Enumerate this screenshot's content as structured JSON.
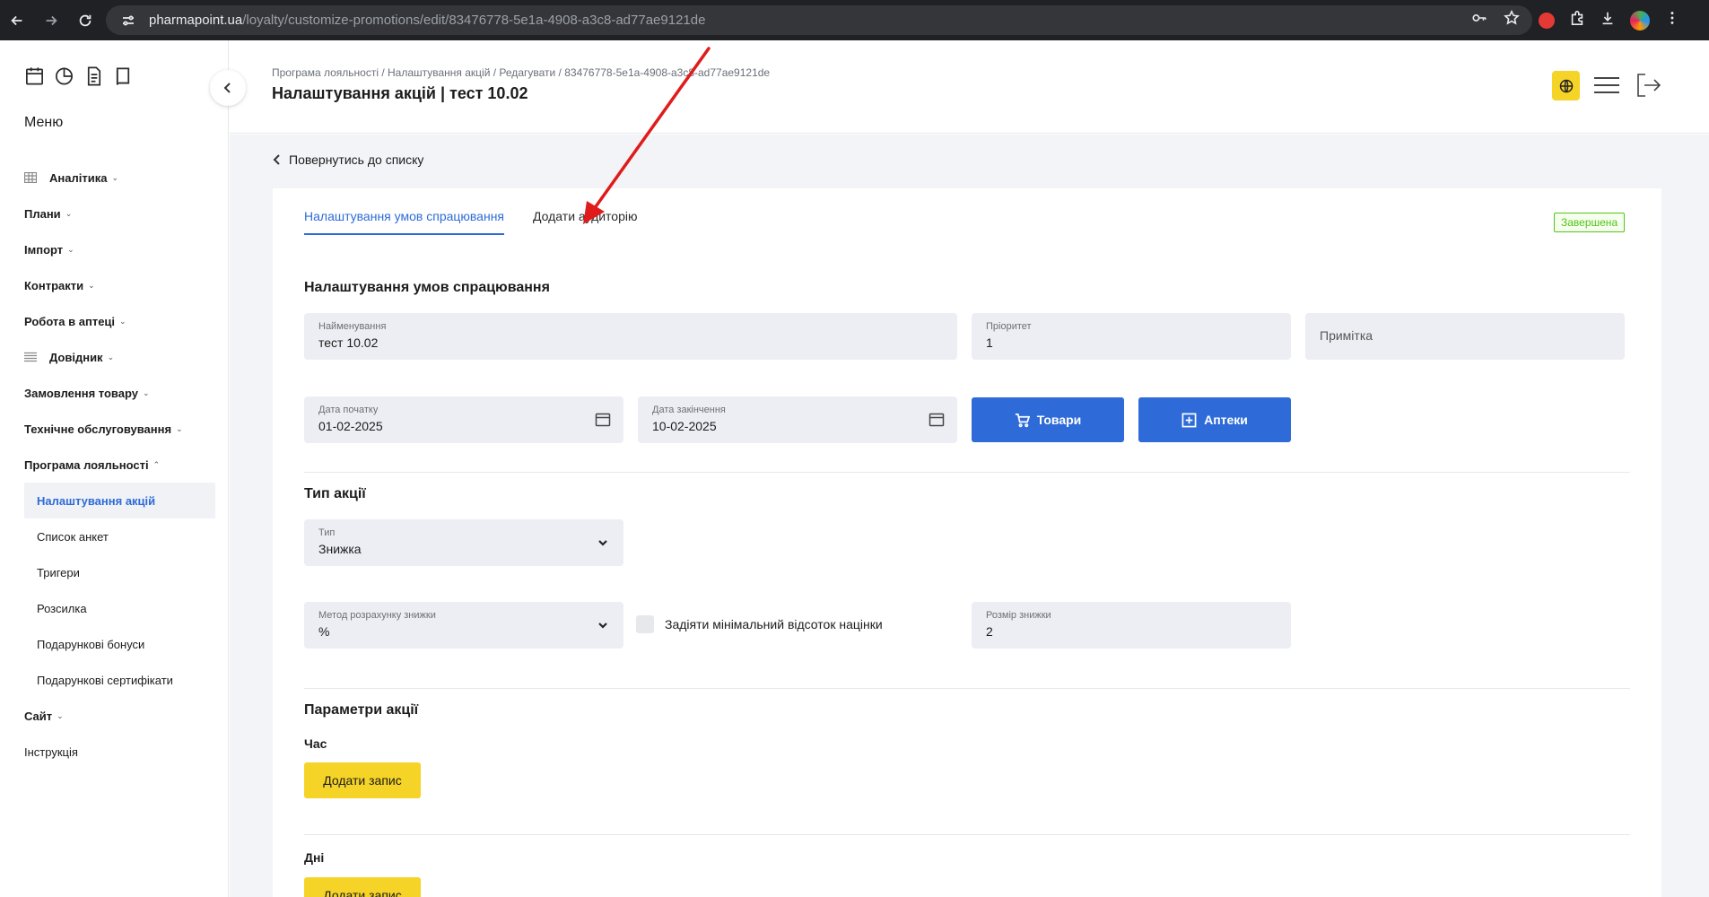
{
  "browser": {
    "url_host": "pharmapoint.ua",
    "url_path": "/loyalty/customize-promotions/edit/83476778-5e1a-4908-a3c8-ad77ae9121de"
  },
  "sidebar": {
    "menu_title": "Меню",
    "items": [
      {
        "label": "Аналітика",
        "icon": "table-icon"
      },
      {
        "label": "Плани"
      },
      {
        "label": "Імпорт"
      },
      {
        "label": "Контракти"
      },
      {
        "label": "Робота в аптеці"
      },
      {
        "label": "Довідник",
        "icon": "list-icon"
      },
      {
        "label": "Замовлення товару"
      },
      {
        "label": "Технічне обслуговування"
      },
      {
        "label": "Програма лояльності"
      }
    ],
    "loyalty_submenu": [
      {
        "label": "Налаштування акцій",
        "active": true
      },
      {
        "label": "Список анкет"
      },
      {
        "label": "Тригери"
      },
      {
        "label": "Розсилка"
      },
      {
        "label": "Подарункові бонуси"
      },
      {
        "label": "Подарункові сертифікати"
      }
    ],
    "after_items": [
      {
        "label": "Сайт"
      },
      {
        "label": "Інструкція"
      }
    ]
  },
  "header": {
    "breadcrumb": "Програма лояльності / Налаштування акцій / Редагувати / 83476778-5e1a-4908-a3c8-ad77ae9121de",
    "title": "Налаштування акцій | тест 10.02"
  },
  "content": {
    "back_label": "Повернутись до списку",
    "tabs": [
      {
        "label": "Налаштування умов спрацювання",
        "active": true
      },
      {
        "label": "Додати аудиторію",
        "active": false
      }
    ],
    "status": "Завершена",
    "section_conditions": "Налаштування умов спрацювання",
    "fields": {
      "name": {
        "label": "Найменування",
        "value": "тест 10.02"
      },
      "priority": {
        "label": "Пріоритет",
        "value": "1"
      },
      "note": {
        "placeholder": "Примітка"
      },
      "start_date": {
        "label": "Дата початку",
        "value": "01-02-2025"
      },
      "end_date": {
        "label": "Дата закінчення",
        "value": "10-02-2025"
      }
    },
    "btn_goods": "Товари",
    "btn_pharmacies": "Аптеки",
    "section_type": "Тип акції",
    "type_select": {
      "label": "Тип",
      "value": "Знижка"
    },
    "method_select": {
      "label": "Метод розрахунку знижки",
      "value": "%"
    },
    "min_markup_checkbox": {
      "label": "Задіяти мінімальний відсоток націнки",
      "checked": false
    },
    "discount_size": {
      "label": "Розмір знижки",
      "value": "2"
    },
    "section_params": "Параметри акції",
    "time_label": "Час",
    "add_record": "Додати запис",
    "days_label": "Дні",
    "add_record_2": "Додати запис"
  },
  "colors": {
    "primary": "#2e6bd8",
    "accent_yellow": "#f5d327",
    "status_green": "#52c41a",
    "annotation_red": "#e01b1b"
  }
}
